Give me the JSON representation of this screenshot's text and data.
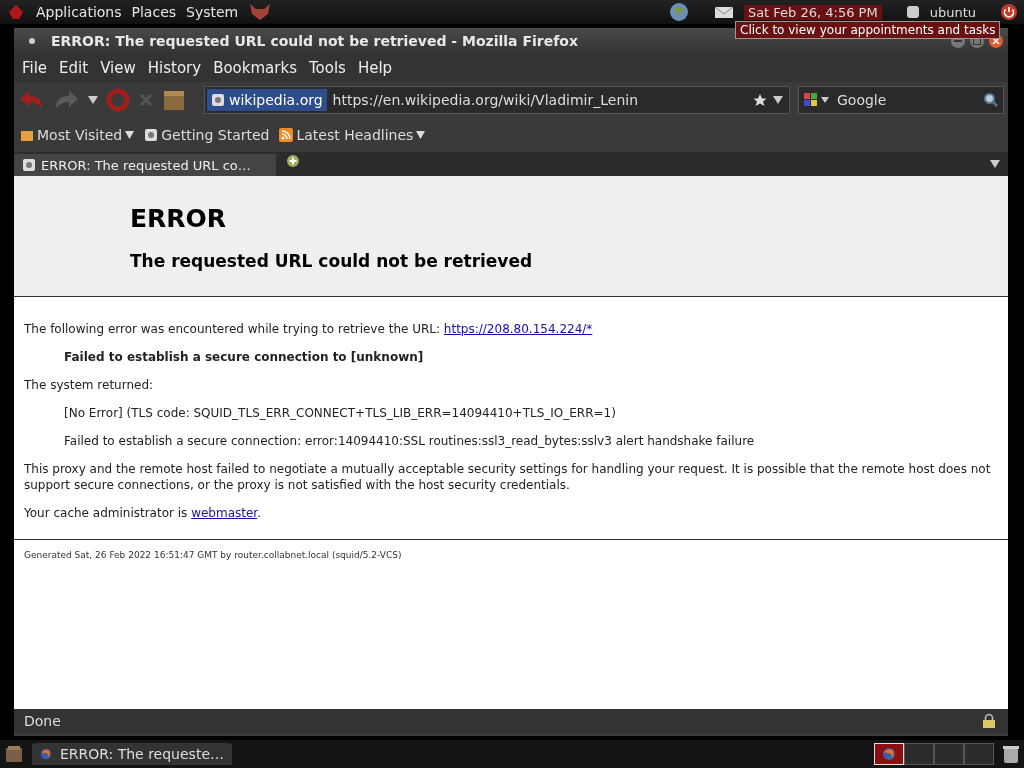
{
  "top_panel": {
    "menus": [
      "Applications",
      "Places",
      "System"
    ],
    "clock": "Sat Feb 26, 4:56 PM",
    "user": "ubuntu",
    "tooltip": "Click to view your appointments and tasks"
  },
  "window": {
    "title": "ERROR: The requested URL could not be retrieved - Mozilla Firefox"
  },
  "menu_bar": [
    "File",
    "Edit",
    "View",
    "History",
    "Bookmarks",
    "Tools",
    "Help"
  ],
  "url_bar": {
    "site": "wikipedia.org",
    "value": "https://en.wikipedia.org/wiki/Vladimir_Lenin"
  },
  "search": {
    "placeholder": "Google"
  },
  "bookmarks": [
    {
      "label": "Most Visited",
      "kind": "folder",
      "menu": true
    },
    {
      "label": "Getting Started",
      "kind": "page",
      "menu": false
    },
    {
      "label": "Latest Headlines",
      "kind": "feed",
      "menu": true
    }
  ],
  "tabs": [
    {
      "label": "ERROR: The requested URL co…",
      "selected": true
    }
  ],
  "page": {
    "heading": "ERROR",
    "subheading": "The requested URL could not be retrieved",
    "intro": "The following error was encountered while trying to retrieve the URL: ",
    "url": "https://208.80.154.224/*",
    "error": "Failed to establish a secure connection to [unknown]",
    "returned_label": "The system returned:",
    "returned": [
      "[No Error] (TLS code: SQUID_TLS_ERR_CONNECT+TLS_LIB_ERR=14094410+TLS_IO_ERR=1)",
      "Failed to establish a secure connection: error:14094410:SSL routines:ssl3_read_bytes:sslv3 alert handshake failure"
    ],
    "explanation": "This proxy and the remote host failed to negotiate a mutually acceptable security settings for handling your request. It is possible that the remote host does not support secure connections, or the proxy is not satisfied with the host security credentials.",
    "admin_text": "Your cache administrator is ",
    "admin_link": "webmaster",
    "admin_end": ".",
    "footer": "Generated Sat, 26 Feb 2022 16:51:47 GMT by router.collabnet.local (squid/5.2-VCS)"
  },
  "status_bar": {
    "text": "Done"
  },
  "taskbar": {
    "items": [
      {
        "label": "ERROR: The requeste…"
      }
    ],
    "workspaces": [
      {
        "selected": true
      },
      {
        "selected": false
      },
      {
        "selected": false
      },
      {
        "selected": false
      }
    ]
  }
}
